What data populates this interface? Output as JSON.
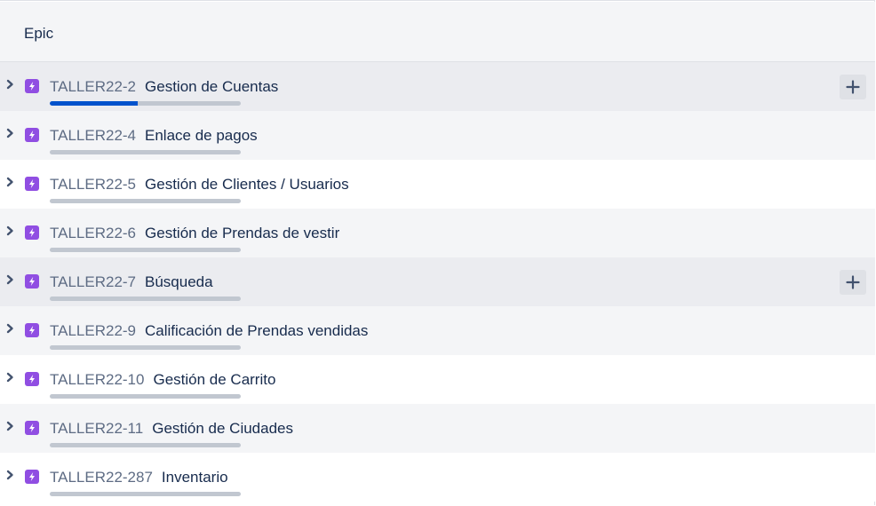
{
  "header": {
    "title": "Epic"
  },
  "rows": [
    {
      "key": "TALLER22-2",
      "summary": "Gestion de Cuentas",
      "progress": 0.46,
      "style": "hover",
      "show_add": true
    },
    {
      "key": "TALLER22-4",
      "summary": "Enlace de pagos",
      "progress": 0,
      "style": "gray",
      "show_add": false
    },
    {
      "key": "TALLER22-5",
      "summary": "Gestión de Clientes / Usuarios",
      "progress": 0,
      "style": "white",
      "show_add": false
    },
    {
      "key": "TALLER22-6",
      "summary": "Gestión de Prendas de vestir",
      "progress": 0,
      "style": "gray",
      "show_add": false
    },
    {
      "key": "TALLER22-7",
      "summary": "Búsqueda",
      "progress": 0,
      "style": "hover",
      "show_add": true
    },
    {
      "key": "TALLER22-9",
      "summary": "Calificación de Prendas vendidas",
      "progress": 0,
      "style": "gray",
      "show_add": false
    },
    {
      "key": "TALLER22-10",
      "summary": "Gestión de Carrito",
      "progress": 0,
      "style": "white",
      "show_add": false
    },
    {
      "key": "TALLER22-11",
      "summary": "Gestión de Ciudades",
      "progress": 0,
      "style": "gray",
      "show_add": false
    },
    {
      "key": "TALLER22-287",
      "summary": "Inventario",
      "progress": 0,
      "style": "white",
      "show_add": false
    }
  ],
  "icons": {
    "expand": "chevron-right-icon",
    "issue_type": "epic-lightning-icon",
    "add": "plus-icon"
  },
  "colors": {
    "epic": "#904ee2",
    "progress_done": "#0052cc",
    "progress_track": "#c1c7d0"
  }
}
